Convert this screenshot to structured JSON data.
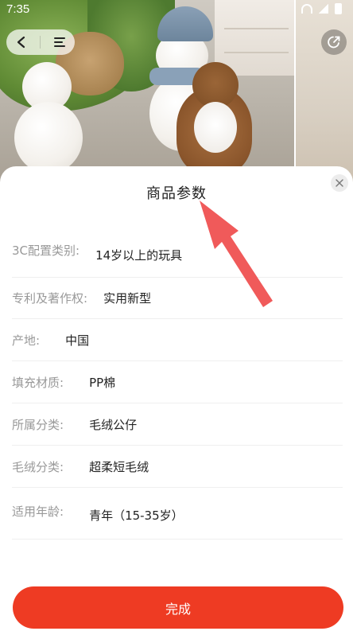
{
  "status_bar": {
    "time": "7:35"
  },
  "sheet": {
    "title": "商品参数",
    "params": [
      {
        "key": "3C配置类别:",
        "value": "14岁以上的玩具"
      },
      {
        "key": "专利及著作权:",
        "value": "实用新型"
      },
      {
        "key": "产地:",
        "value": "中国"
      },
      {
        "key": "填充材质:",
        "value": "PP棉"
      },
      {
        "key": "所属分类:",
        "value": "毛绒公仔"
      },
      {
        "key": "毛绒分类:",
        "value": "超柔短毛绒"
      },
      {
        "key": "适用年龄:",
        "value": "青年（15-35岁）"
      }
    ],
    "done_label": "完成"
  },
  "colors": {
    "accent": "#ee3b23",
    "annotation_arrow": "#f05a5a"
  },
  "icons": [
    "back-arrow-icon",
    "menu-icon",
    "share-icon",
    "close-icon",
    "wifi-icon",
    "signal-icon",
    "battery-icon"
  ]
}
